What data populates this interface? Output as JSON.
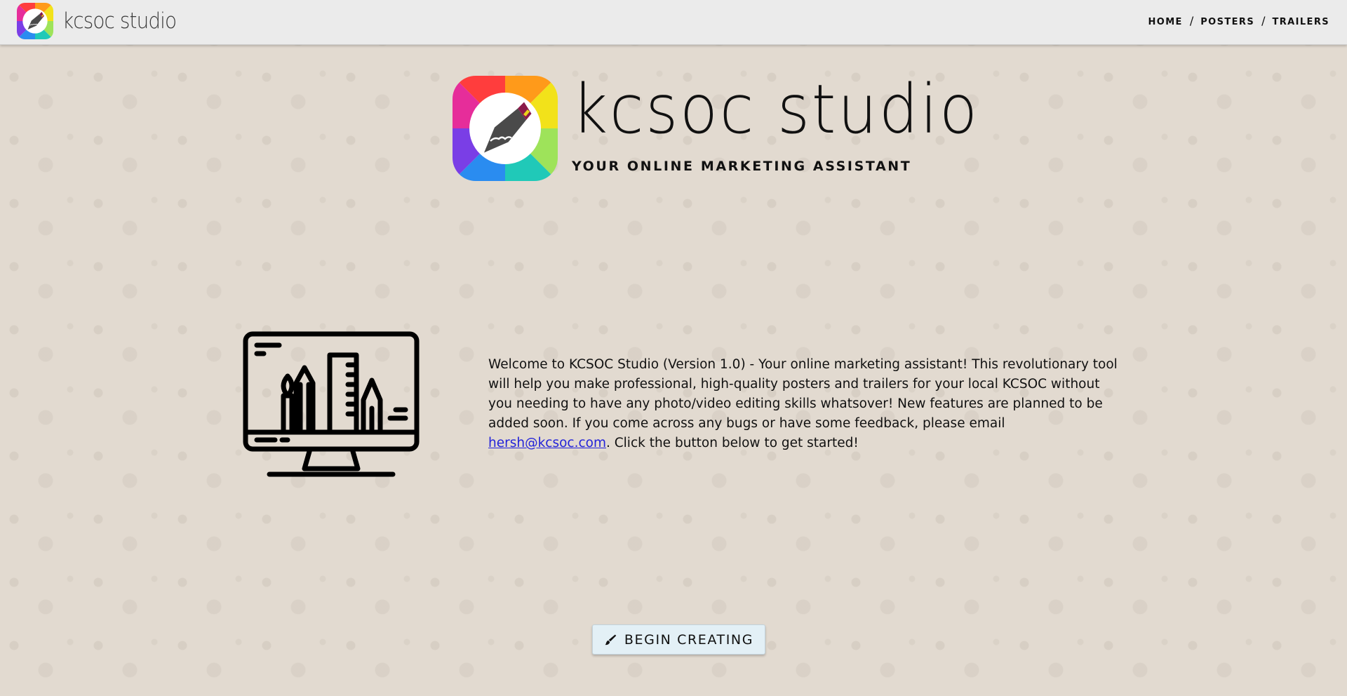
{
  "navbar": {
    "brand_text": "kcsoc studio",
    "links": [
      {
        "label": "HOME"
      },
      {
        "label": "POSTERS"
      },
      {
        "label": "TRAILERS"
      }
    ],
    "separator": "/"
  },
  "hero": {
    "title": "kcsoc studio",
    "tagline": "YOUR ONLINE MARKETING ASSISTANT",
    "logo_icon": "pen-nib-badge-icon"
  },
  "intro": {
    "text_before": "Welcome to KCSOC Studio (Version 1.0) - Your online marketing assistant! This revolutionary tool will help you make professional, high-quality posters and trailers for your local KCSOC without you needing to have any photo/video editing skills whatsover! New features are planned to be added soon. If you come across any bugs or have some feedback, please email ",
    "email": "hersh@kcsoc.com",
    "text_after": ". Click the button below to get started!",
    "illustration_icon": "design-tools-monitor-icon"
  },
  "actions": {
    "begin_label": "BEGIN CREATING",
    "begin_icon": "paintbrush-icon"
  },
  "colors": {
    "nav_bg": "#ebebeb",
    "page_bg": "#e2dad0",
    "button_bg": "#e3f0f6",
    "link": "#2323d9"
  }
}
